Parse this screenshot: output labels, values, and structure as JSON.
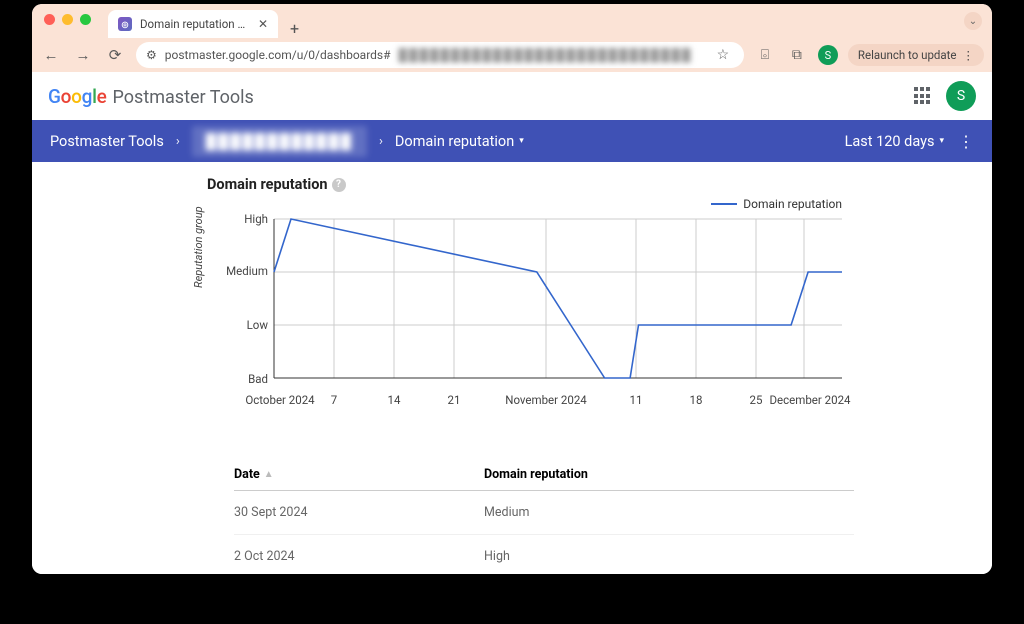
{
  "browser": {
    "tab_title": "Domain reputation – Postma…",
    "url_visible": "postmaster.google.com/u/0/dashboards#",
    "relaunch_label": "Relaunch to update",
    "avatar_initial": "S"
  },
  "header": {
    "product": "Postmaster Tools",
    "avatar_initial": "S"
  },
  "breadcrumb": {
    "root": "Postmaster Tools",
    "domain_blurred": "████████████",
    "section": "Domain reputation",
    "range": "Last 120 days"
  },
  "section": {
    "title": "Domain reputation"
  },
  "legend": {
    "series": "Domain reputation"
  },
  "yaxis": {
    "label": "Reputation group",
    "ticks": [
      "High",
      "Medium",
      "Low",
      "Bad"
    ]
  },
  "xaxis": {
    "ticks": [
      "October 2024",
      "7",
      "14",
      "21",
      "November 2024",
      "11",
      "18",
      "25",
      "December 2024"
    ]
  },
  "table": {
    "col_date": "Date",
    "col_rep": "Domain reputation",
    "rows": [
      {
        "date": "30 Sept 2024",
        "rep": "Medium"
      },
      {
        "date": "2 Oct 2024",
        "rep": "High"
      }
    ]
  },
  "chart_data": {
    "type": "line",
    "title": "Domain reputation",
    "xlabel": "",
    "ylabel": "Reputation group",
    "ylevels": [
      "Bad",
      "Low",
      "Medium",
      "High"
    ],
    "series": [
      {
        "name": "Domain reputation",
        "points": [
          {
            "x": "30 Sep 2024",
            "y": "Medium"
          },
          {
            "x": "2 Oct 2024",
            "y": "High"
          },
          {
            "x": "31 Oct 2024",
            "y": "Medium"
          },
          {
            "x": "4 Nov 2024",
            "y": "Low"
          },
          {
            "x": "8 Nov 2024",
            "y": "Bad"
          },
          {
            "x": "11 Nov 2024",
            "y": "Bad"
          },
          {
            "x": "12 Nov 2024",
            "y": "Low"
          },
          {
            "x": "30 Nov 2024",
            "y": "Low"
          },
          {
            "x": "2 Dec 2024",
            "y": "Medium"
          },
          {
            "x": "6 Dec 2024",
            "y": "Medium"
          }
        ]
      }
    ],
    "x_tick_labels": [
      "October 2024",
      "7",
      "14",
      "21",
      "November 2024",
      "11",
      "18",
      "25",
      "December 2024"
    ]
  }
}
